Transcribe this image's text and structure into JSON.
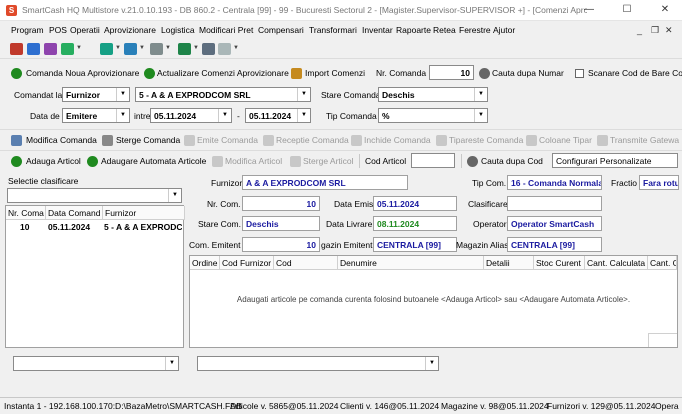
{
  "window": {
    "title": "SmartCash HQ Multistore v.21.0.10.193 - DB 860.2 - Centrala [99] - 99 - Bucuresti Sectorul 2 - [Magister.Supervisor-SUPERVISOR +] - [Comenzi Aprovizi...",
    "icon": "S",
    "minimize": "—",
    "maximize": "☐",
    "close": "✕"
  },
  "menu": [
    "Program",
    "POS",
    "Operatii",
    "Aprovizionare",
    "Logistica",
    "Modificari Pret",
    "Compensari",
    "Transformari",
    "Inventar",
    "Rapoarte",
    "Retea",
    "Ferestre",
    "Ajutor"
  ],
  "mdi_controls": {
    "minimize": "_",
    "restore": "❐",
    "close": "✕"
  },
  "toolbar_icons": [
    "print-icon",
    "users-icon",
    "settings-icon",
    "cart-icon",
    "cart-add-icon",
    "transfer-icon",
    "gear-icon",
    "chart-icon",
    "box-icon"
  ],
  "actions": {
    "new_order": "Comanda Noua Aprovizionare",
    "update_orders": "Actualizare Comenzi Aprovizionare",
    "import_orders": "Import Comenzi",
    "order_no_label": "Nr. Comanda",
    "order_no_value": "10",
    "search_by_number": "Cauta dupa Numar",
    "scan_barcode": "Scanare Cod de Bare Co"
  },
  "filters": {
    "order_to_label": "Comandat la",
    "order_to_value": "Furnizor",
    "supplier_value": "5 - A & A EXPRODCOM SRL",
    "status_label": "Stare Comanda",
    "status_value": "Deschis",
    "date_label": "Data de",
    "date_type_value": "Emitere",
    "between_label": "intre",
    "date_from": "05.11.2024",
    "date_sep": "-",
    "date_to": "05.11.2024",
    "type_label": "Tip Comanda",
    "type_value": "%"
  },
  "order_toolbar": {
    "edit": "Modifica Comanda",
    "delete": "Sterge Comanda",
    "emit": "Emite Comanda",
    "receive": "Receptie Comanda",
    "close": "Inchide Comanda",
    "print": "Tipareste Comanda",
    "print_columns": "Coloane Tipar",
    "send_gateway": "Transmite Gatewa"
  },
  "article_toolbar": {
    "add": "Adauga Articol",
    "auto_add": "Adaugare Automata Articole",
    "edit": "Modifica Articol",
    "delete": "Sterge Articol",
    "article_code_label": "Cod Articol",
    "search_by_code": "Cauta dupa Cod",
    "settings_value": "Configurari Personalizate"
  },
  "left_panel": {
    "classification_label": "Selectie clasificare",
    "columns": [
      "Nr. Coma",
      "Data Comand",
      "Furnizor"
    ],
    "rows": [
      {
        "nr": "10",
        "date": "05.11.2024",
        "supplier": "5 - A & A EXPRODCOM"
      }
    ]
  },
  "details": {
    "supplier_label": "Furnizor",
    "supplier_value": "A & A EXPRODCOM SRL",
    "type_label": "Tip Com.",
    "type_value": "16 - Comanda Normala",
    "invoice_label": "Fractio",
    "invoice_value": "Fara rotu",
    "order_no_label": "Nr. Com.",
    "order_no_value": "10",
    "issue_date_label": "Data Emis",
    "issue_date_value": "05.11.2024",
    "classification_label": "Clasificare",
    "classification_value": "",
    "status_label": "Stare Com.",
    "status_value": "Deschis",
    "delivery_label": "Data Livrare",
    "delivery_value": "08.11.2024",
    "operator_label": "Operator",
    "operator_value": "Operator SmartCash",
    "issued_label": "Com. Emitent",
    "issued_value": "10",
    "store_issuer_label": "gazin Emitent",
    "store_issuer_value": "CENTRALA [99]",
    "store_alias_label": "Magazin Alias",
    "store_alias_value": "CENTRALA [99]"
  },
  "items_grid": {
    "columns": [
      "Ordine",
      "Cod Furnizor",
      "Cod",
      "Denumire",
      "Detalii",
      "Stoc Curent",
      "Cant. Calculata",
      "Cant. C"
    ],
    "empty_message": "Adaugati articole pe comanda curenta folosind butoanele <Adauga Articol> sau <Adaugare Automata Articole>."
  },
  "status_bar": {
    "instance": "Instanta 1 - 192.168.100.170:D:\\BazaMetro\\SMARTCASH.FDB",
    "articles": "Articole v. 5865@05.11.2024",
    "clients": "Clienti v. 146@05.11.2024",
    "stores": "Magazine v. 98@05.11.2024",
    "suppliers": "Furnizori v. 129@05.11.2024",
    "ops": "Opera"
  },
  "colors": {
    "accent_blue": "#1a1aa0",
    "accent_green": "#1f8a1f",
    "disabled": "#9a9a9a"
  }
}
